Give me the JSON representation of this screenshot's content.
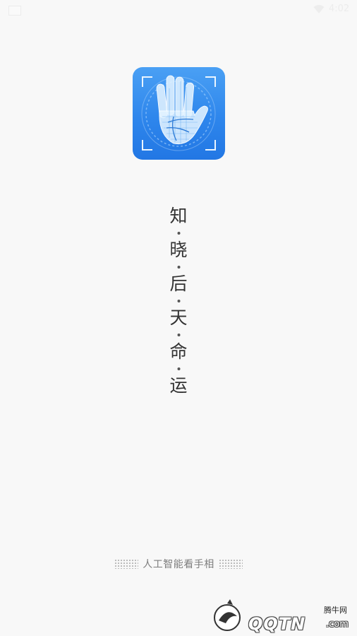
{
  "status_bar": {
    "time": "4:02",
    "icons": [
      "notification-icon",
      "wifi-icon"
    ]
  },
  "app": {
    "logo_icon": "palm-scan-icon",
    "brand_color": "#2e86ec"
  },
  "slogan": {
    "chars": [
      "知",
      "晓",
      "后",
      "天",
      "命",
      "运"
    ]
  },
  "tagline": {
    "text": "人工智能看手相"
  },
  "watermark": {
    "small_text": "腾牛网",
    "main_text": "QQTN",
    "suffix": ".com"
  },
  "colors": {
    "background": "#f8f8f8",
    "slogan_text": "#333333",
    "tagline_text": "#7d7d7d"
  }
}
